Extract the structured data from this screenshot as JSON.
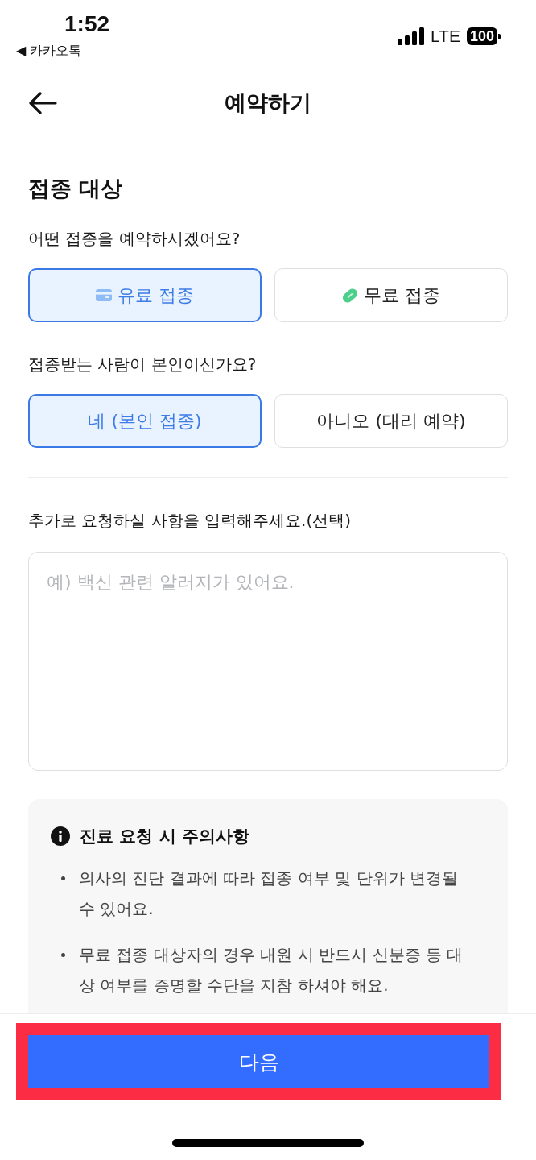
{
  "status_bar": {
    "time": "1:52",
    "back_app": "◀ 카카오톡",
    "network": "LTE",
    "battery": "100"
  },
  "header": {
    "title": "예약하기"
  },
  "section": {
    "title": "접종 대상"
  },
  "questions": [
    {
      "label": "어떤 접종을 예약하시겠어요?",
      "options": [
        {
          "label": "유료 접종",
          "kind": "card",
          "selected": true
        },
        {
          "label": "무료 접종",
          "kind": "ticket",
          "selected": false
        }
      ]
    },
    {
      "label": "접종받는 사람이 본인이신가요?",
      "options": [
        {
          "label": "네 (본인 접종)",
          "kind": "plain",
          "selected": true
        },
        {
          "label": "아니오 (대리 예약)",
          "kind": "plain",
          "selected": false
        }
      ]
    }
  ],
  "request": {
    "label": "추가로 요청하실 사항을 입력해주세요.(선택)",
    "placeholder": "예) 백신 관련 알러지가 있어요."
  },
  "notice": {
    "title": "진료 요청 시 주의사항",
    "items": [
      "의사의 진단 결과에 따라 접종 여부 및 단위가 변경될 수 있어요.",
      "무료 접종 대상자의 경우 내원 시 반드시 신분증 등 대상 여부를 증명할 수단을 지참 하셔야 해요."
    ]
  },
  "next_button": {
    "label": "다음",
    "highlighted": true
  }
}
